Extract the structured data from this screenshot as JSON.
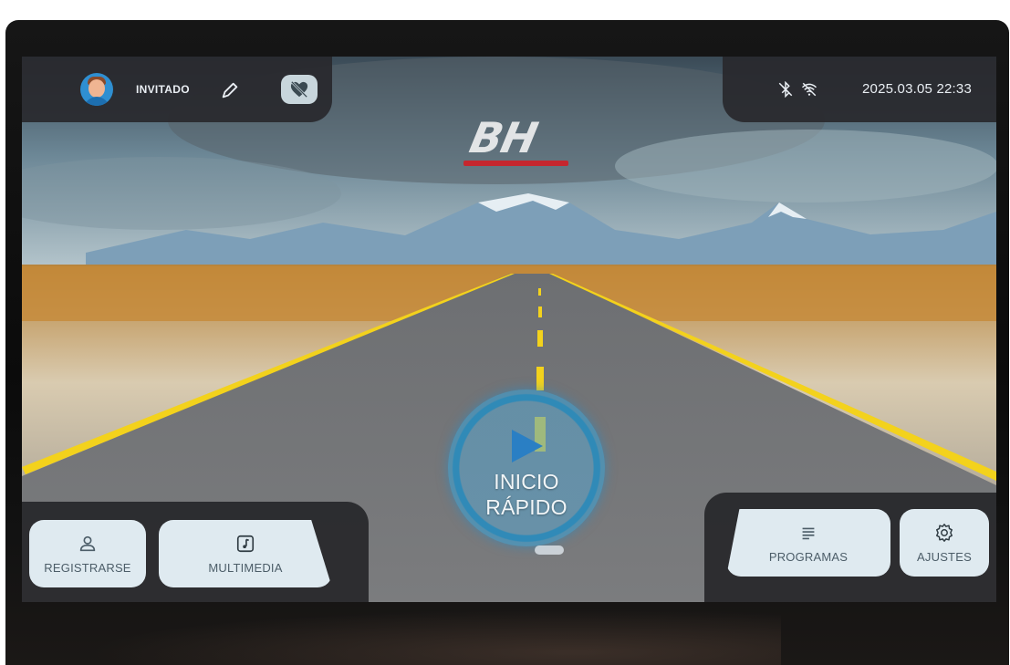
{
  "header": {
    "user_name": "INVITADO",
    "datetime": "2025.03.05 22:33",
    "logo_text": "BH"
  },
  "icons": {
    "avatar": "user-avatar",
    "edit": "pencil-icon",
    "favorite": "heart-off-icon",
    "bluetooth": "bluetooth-off-icon",
    "wifi": "wifi-off-icon",
    "play": "play-icon",
    "register": "user-outline-icon",
    "multimedia": "music-note-icon",
    "programas": "list-icon",
    "ajustes": "gear-icon"
  },
  "quick_start": {
    "line1": "INICIO",
    "line2": "RÁPIDO"
  },
  "bottom_left": {
    "register_label": "REGISTRARSE",
    "multimedia_label": "MULTIMEDIA"
  },
  "bottom_right": {
    "programas_label": "PROGRAMAS",
    "ajustes_label": "AJUSTES"
  },
  "colors": {
    "accent_blue": "#2f8fd1",
    "logo_red": "#c5262e",
    "button_bg": "#dfeaf0",
    "road_line": "#f3d21c"
  }
}
